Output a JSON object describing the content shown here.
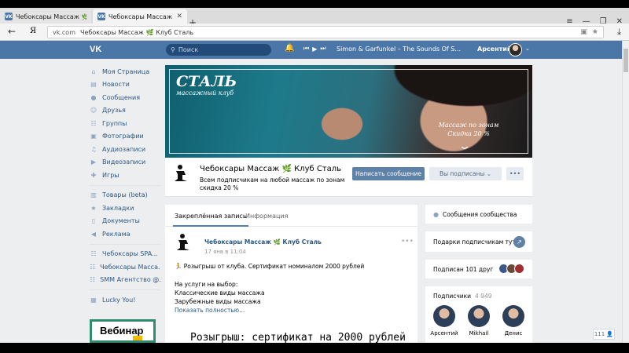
{
  "browser": {
    "tabs": [
      {
        "label": "Чебоксары Массаж 🌿 Клуб",
        "favicon": "VK"
      },
      {
        "label": "Чебоксары Массаж 🌿 Кл",
        "favicon": "VK"
      }
    ],
    "new_tab": "+",
    "back": "←",
    "yandex": "Я",
    "url_domain": "vk.com",
    "url_title": "Чебоксары Массаж 🌿 Клуб Сталь",
    "window_controls": [
      "≡",
      "—",
      "❐",
      "✕"
    ]
  },
  "vk_header": {
    "logo": "VK",
    "search_placeholder": "Поиск",
    "track": "Simon & Garfunkel – The Sounds Of S...",
    "user": "Арсентий"
  },
  "left_nav": {
    "main": [
      {
        "label": "Моя Страница",
        "icon": "home-icon"
      },
      {
        "label": "Новости",
        "icon": "news-icon"
      },
      {
        "label": "Сообщения",
        "icon": "chat-icon"
      },
      {
        "label": "Друзья",
        "icon": "friends-icon"
      },
      {
        "label": "Группы",
        "icon": "groups-icon"
      },
      {
        "label": "Фотографии",
        "icon": "photo-icon"
      },
      {
        "label": "Аудиозаписи",
        "icon": "music-icon"
      },
      {
        "label": "Видеозаписи",
        "icon": "video-icon"
      },
      {
        "label": "Игры",
        "icon": "games-icon"
      }
    ],
    "secondary": [
      {
        "label": "Товары (beta)",
        "icon": "goods-icon"
      },
      {
        "label": "Закладки",
        "icon": "star-icon"
      },
      {
        "label": "Документы",
        "icon": "docs-icon"
      },
      {
        "label": "Реклама",
        "icon": "ads-icon"
      }
    ],
    "groups": [
      {
        "label": "Чебоксары SPA...",
        "icon": "group-icon"
      },
      {
        "label": "Чебоксары Масса...",
        "icon": "group-icon"
      },
      {
        "label": "SMM Агентство @...",
        "icon": "group-icon"
      }
    ],
    "apps": [
      {
        "label": "Lucky You!",
        "icon": "app-icon"
      }
    ],
    "webinar_label": "Вебинар"
  },
  "cover": {
    "brand": "СТАЛЬ",
    "subtitle": "массажный клуб",
    "promo_line1": "Массаж по зонам",
    "promo_line2": "Скидка 20 %"
  },
  "group": {
    "name": "Чебоксары Массаж 🌿 Клуб Сталь",
    "status": "Всем подписчикам на любой массаж по зонам скидка 20 %",
    "btn_message": "Написать сообщение",
    "btn_subscribed": "Вы подписаны ⌄",
    "btn_more": "•••"
  },
  "feed": {
    "tab_pinned": "Закреплённая запись",
    "tab_info": "Информация",
    "post": {
      "author": "Чебоксары Массаж 🌿 Клуб Сталь",
      "date": "17 янв в 11:04",
      "line1": "🏃 Розыгрыш от клуба. Сертификат номиналом 2000 рублей",
      "line2": "На услуги на выбор:",
      "line3": "Классические виды массажа",
      "line4": "Зарубежные виды массажа",
      "more": "Показать полностью...",
      "big": "Розыгрыш: сертификат на 2000 рублей"
    }
  },
  "right": {
    "community_messages": "Сообщения сообщества",
    "gifts": "Подарки подписчикам тут",
    "friends_subscribed": "Подписан 101 друг",
    "subscribers_label": "Подписчики",
    "subscribers_count": "4 949",
    "subscribers": [
      {
        "name": "Арсентий"
      },
      {
        "name": "Mikhail"
      },
      {
        "name": "Денис"
      }
    ]
  },
  "badge": "111 👤"
}
